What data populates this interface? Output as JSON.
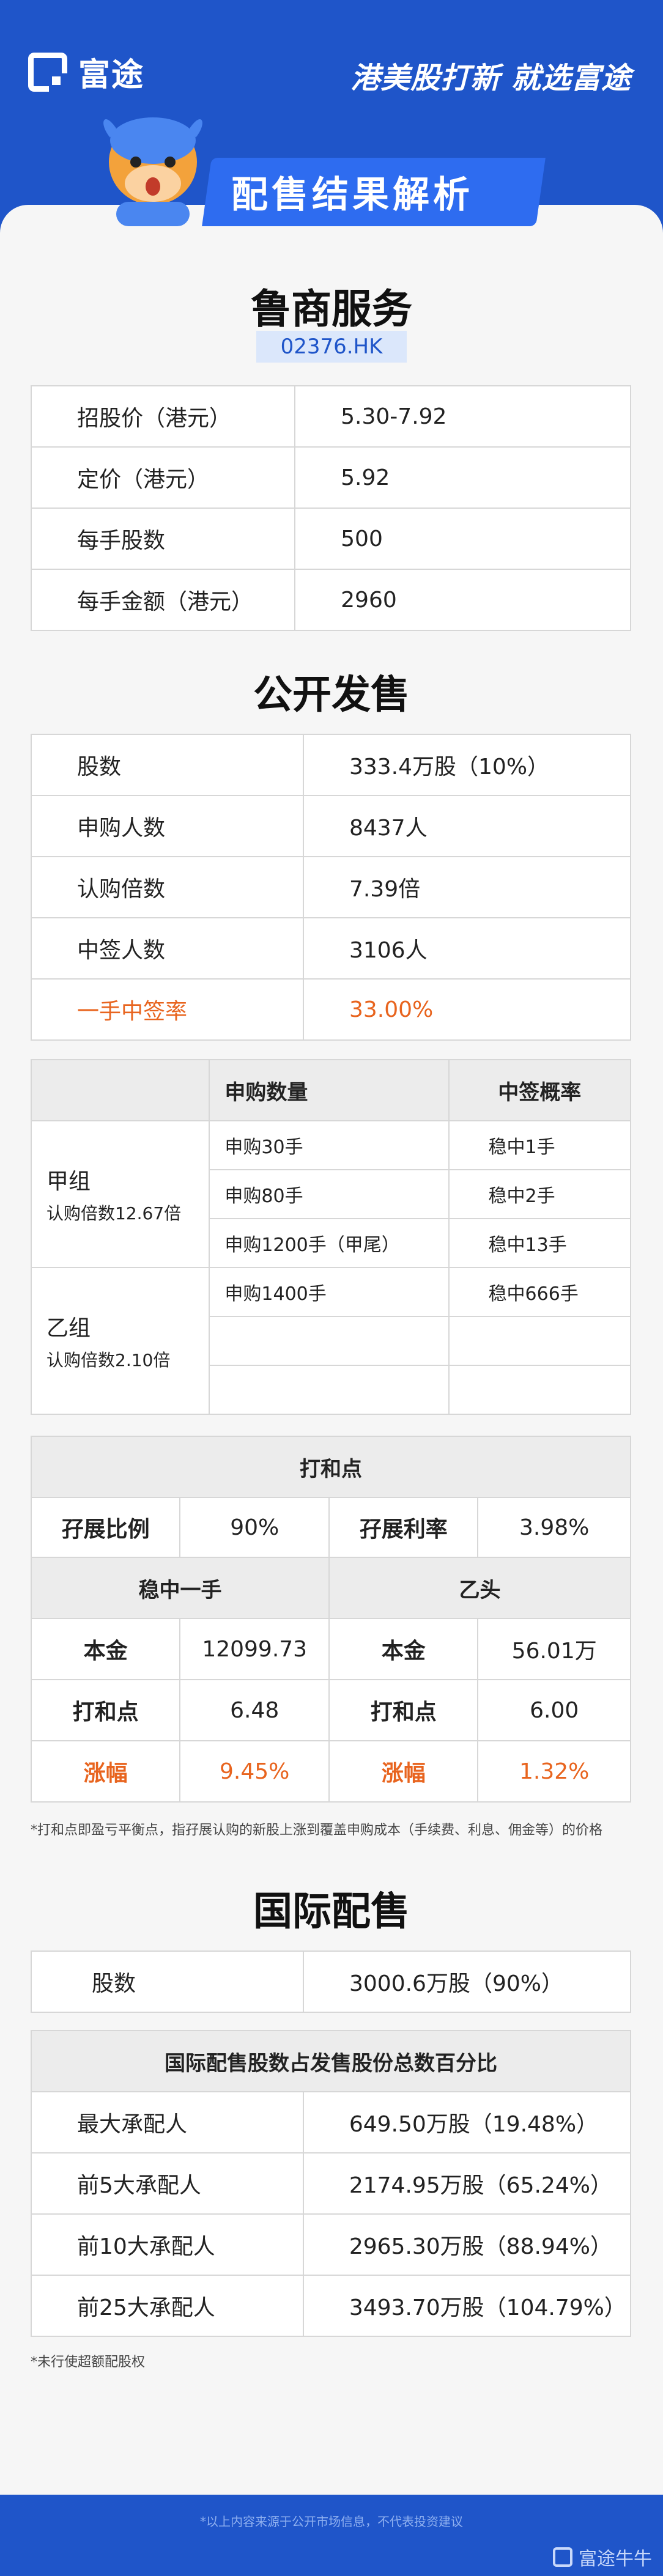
{
  "header": {
    "logo_text": "富途",
    "slogan": "港美股打新 就选富途",
    "banner_title": "配售结果解析"
  },
  "stock": {
    "name": "鲁商服务",
    "code": "02376.HK"
  },
  "basic_info": [
    {
      "label": "招股价（港元）",
      "value": "5.30-7.92"
    },
    {
      "label": "定价（港元）",
      "value": "5.92"
    },
    {
      "label": "每手股数",
      "value": "500"
    },
    {
      "label": "每手金额（港元）",
      "value": "2960"
    }
  ],
  "public_offer": {
    "title": "公开发售",
    "rows": [
      {
        "label": "股数",
        "value": "333.4万股（10%）"
      },
      {
        "label": "申购人数",
        "value": "8437人"
      },
      {
        "label": "认购倍数",
        "value": "7.39倍"
      },
      {
        "label": "中签人数",
        "value": "3106人"
      },
      {
        "label": "一手中签率",
        "value": "33.00%"
      }
    ]
  },
  "allotment": {
    "headers": [
      "申购数量",
      "中签概率"
    ],
    "group_a": {
      "name": "甲组",
      "sub": "认购倍数12.67倍",
      "rows": [
        {
          "qty": "申购30手",
          "prob": "稳中1手"
        },
        {
          "qty": "申购80手",
          "prob": "稳中2手"
        },
        {
          "qty": "申购1200手（甲尾）",
          "prob": "稳中13手"
        }
      ]
    },
    "group_b": {
      "name": "乙组",
      "sub": "认购倍数2.10倍",
      "rows": [
        {
          "qty": "申购1400手",
          "prob": "稳中666手"
        },
        {
          "qty": "",
          "prob": ""
        },
        {
          "qty": "",
          "prob": ""
        }
      ]
    }
  },
  "breakeven": {
    "title": "打和点",
    "margin_ratio_label": "孖展比例",
    "margin_ratio": "90%",
    "margin_rate_label": "孖展利率",
    "margin_rate": "3.98%",
    "left_title": "稳中一手",
    "right_title": "乙头",
    "principal_label": "本金",
    "breakeven_label": "打和点",
    "rise_label": "涨幅",
    "left": {
      "principal": "12099.73",
      "breakeven": "6.48",
      "rise": "9.45%"
    },
    "right": {
      "principal": "56.01万",
      "breakeven": "6.00",
      "rise": "1.32%"
    },
    "footnote": "*打和点即盈亏平衡点，指孖展认购的新股上涨到覆盖申购成本（手续费、利息、佣金等）的价格"
  },
  "intl_offer": {
    "title": "国际配售",
    "shares_label": "股数",
    "shares_value": "3000.6万股（90%）",
    "table_title": "国际配售股数占发售股份总数百分比",
    "rows": [
      {
        "label": "最大承配人",
        "value": "649.50万股（19.48%）"
      },
      {
        "label": "前5大承配人",
        "value": "2174.95万股（65.24%）"
      },
      {
        "label": "前10大承配人",
        "value": "2965.30万股（88.94%）"
      },
      {
        "label": "前25大承配人",
        "value": "3493.70万股（104.79%）"
      }
    ],
    "footnote": "*未行使超额配股权"
  },
  "footer": {
    "disclaimer": "*以上内容来源于公开市场信息，不代表投资建议",
    "brand": "富途牛牛"
  },
  "colors": {
    "brand_blue": "#1f55c9",
    "accent_orange": "#e8641e",
    "highlight_peach": "#f4c5a8"
  }
}
